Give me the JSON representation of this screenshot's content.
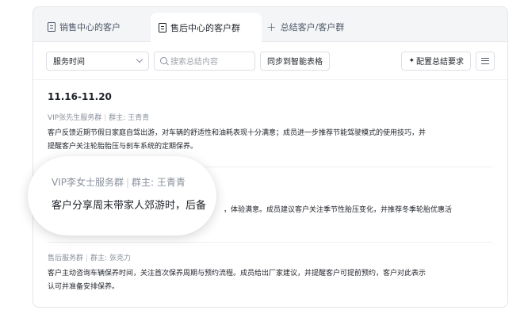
{
  "tabs": [
    {
      "label": "销售中心的客户"
    },
    {
      "label": "售后中心的客户群"
    },
    {
      "label": "总结客户/客户群"
    }
  ],
  "toolbar": {
    "select_value": "服务时间",
    "search_placeholder": "搜索总结内容",
    "sync_label": "同步到智能表格",
    "config_label": "配置总结要求"
  },
  "summary": {
    "date": "11.16-11.20",
    "items": [
      {
        "group": "VIP张先生服务群",
        "owner": "群主: 王青青",
        "text_line1": "客户反馈近期节假日家庭自驾出游，对车辆的舒适性和油耗表现十分满意；成员进一步推荐节能驾驶模式的使用技巧，并",
        "text_line2": "提醒客户关注轮胎胎压与刹车系统的定期保养。"
      },
      {
        "text_visible": "，体验满意。成员建议客户关注季节性胎压变化，并推荐冬季轮胎优惠活"
      },
      {
        "group": "售后服务群",
        "owner": "群主: 张克力",
        "text_line1": "客户主动咨询车辆保养时间，关注首次保养周期与预约流程。成员给出厂家建议，并提醒客户可提前预约，客户对此表示",
        "text_line2": "认可并准备安排保养。"
      }
    ]
  },
  "magnifier": {
    "group": "VIP李女士服务群",
    "owner": "群主: 王青青",
    "text": "客户分享周末带家人郊游时，后备"
  },
  "icons": [
    "doc-icon",
    "plus-icon",
    "chevron-down-icon",
    "search-icon",
    "sparkle-icon",
    "menu-icon"
  ]
}
